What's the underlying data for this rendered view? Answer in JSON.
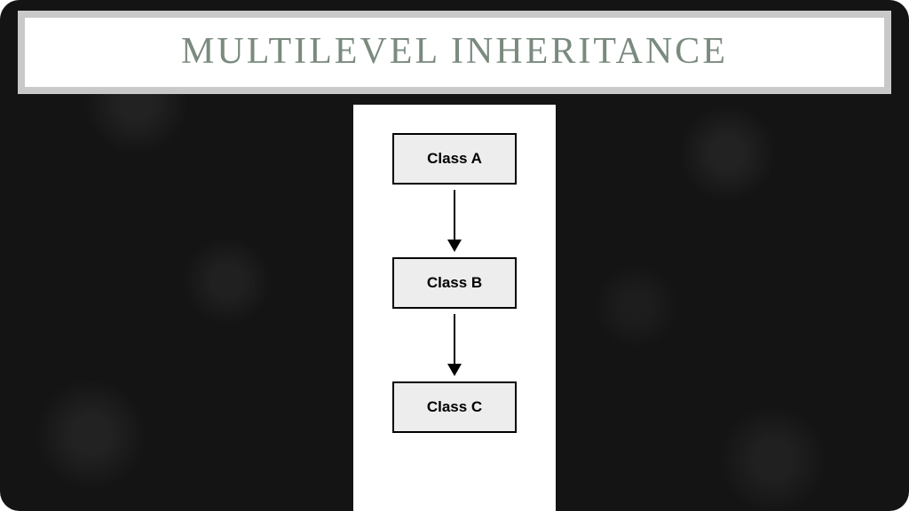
{
  "title": "Multilevel Inheritance",
  "diagram": {
    "nodes": [
      {
        "label": "Class A"
      },
      {
        "label": "Class B"
      },
      {
        "label": "Class C"
      }
    ]
  }
}
